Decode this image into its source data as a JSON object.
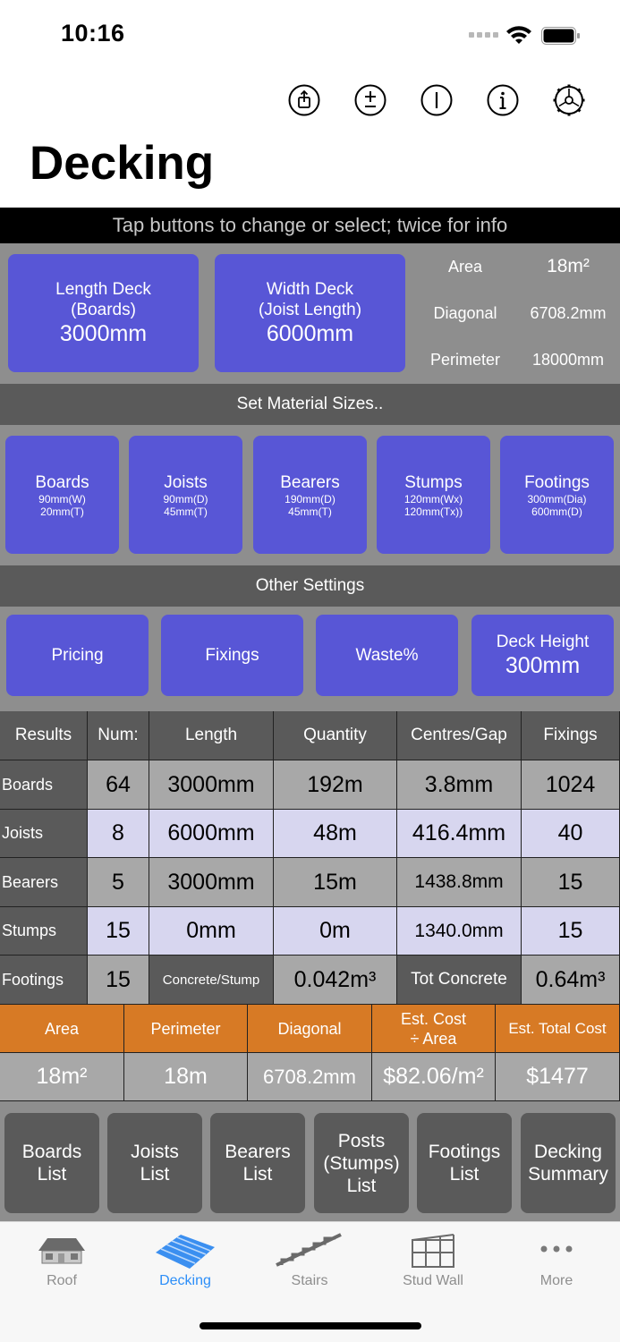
{
  "status": {
    "time": "10:16"
  },
  "toolbar": {
    "icons": [
      "share-icon",
      "plus-minus-icon",
      "info-circle-i-icon",
      "info-icon",
      "settings-gear-icon"
    ]
  },
  "title": "Decking",
  "hint": "Tap buttons to change or select; twice for info",
  "deck": {
    "length": {
      "line1": "Length Deck",
      "line2": "(Boards)",
      "value": "3000mm"
    },
    "width": {
      "line1": "Width Deck",
      "line2": "(Joist Length)",
      "value": "6000mm"
    },
    "stats": [
      {
        "label": "Area",
        "value": "18m²"
      },
      {
        "label": "Diagonal",
        "value": "6708.2mm"
      },
      {
        "label": "Perimeter",
        "value": "18000mm"
      }
    ]
  },
  "material_header": "Set Material Sizes..",
  "materials": [
    {
      "name": "Boards",
      "l1": "90mm(W)",
      "l2": "20mm(T)"
    },
    {
      "name": "Joists",
      "l1": "90mm(D)",
      "l2": "45mm(T)"
    },
    {
      "name": "Bearers",
      "l1": "190mm(D)",
      "l2": "45mm(T)"
    },
    {
      "name": "Stumps",
      "l1": "120mm(Wx)",
      "l2": "120mm(Tx))"
    },
    {
      "name": "Footings",
      "l1": "300mm(Dia)",
      "l2": "600mm(D)"
    }
  ],
  "other_header": "Other Settings",
  "settings": [
    {
      "label": "Pricing"
    },
    {
      "label": "Fixings"
    },
    {
      "label": "Waste%"
    },
    {
      "label": "Deck Height",
      "value": "300mm"
    }
  ],
  "table": {
    "headers": [
      "Results",
      "Num:",
      "Length",
      "Quantity",
      "Centres/Gap",
      "Fixings"
    ],
    "rows": [
      [
        "Boards",
        "64",
        "3000mm",
        "192m",
        "3.8mm",
        "1024"
      ],
      [
        "Joists",
        "8",
        "6000mm",
        "48m",
        "416.4mm",
        "40"
      ],
      [
        "Bearers",
        "5",
        "3000mm",
        "15m",
        "1438.8mm",
        "15"
      ],
      [
        "Stumps",
        "15",
        "0mm",
        "0m",
        "1340.0mm",
        "15"
      ],
      [
        "Footings",
        "15",
        "Concrete/Stump",
        "0.042m³",
        "Tot Concrete",
        "0.64m³"
      ]
    ]
  },
  "summary": {
    "headers": [
      "Area",
      "Perimeter",
      "Diagonal",
      "Est. Cost\n÷ Area",
      "Est. Total Cost"
    ],
    "values": [
      "18m²",
      "18m",
      "6708.2mm",
      "$82.06/m²",
      "$1477"
    ]
  },
  "lists": [
    "Boards\nList",
    "Joists\nList",
    "Bearers\nList",
    "Posts\n(Stumps)\nList",
    "Footings\nList",
    "Decking\nSummary"
  ],
  "tabs": [
    {
      "label": "Roof",
      "icon": "roof-house-icon"
    },
    {
      "label": "Decking",
      "icon": "decking-icon",
      "active": true
    },
    {
      "label": "Stairs",
      "icon": "stairs-icon"
    },
    {
      "label": "Stud Wall",
      "icon": "stud-wall-icon"
    },
    {
      "label": "More",
      "icon": "more-icon"
    }
  ],
  "colors": {
    "accent": "#5856d6",
    "orange": "#d77a25",
    "tab_active": "#2c8ef8",
    "panel": "#8e8e8e",
    "dark": "#5a5a5a"
  }
}
